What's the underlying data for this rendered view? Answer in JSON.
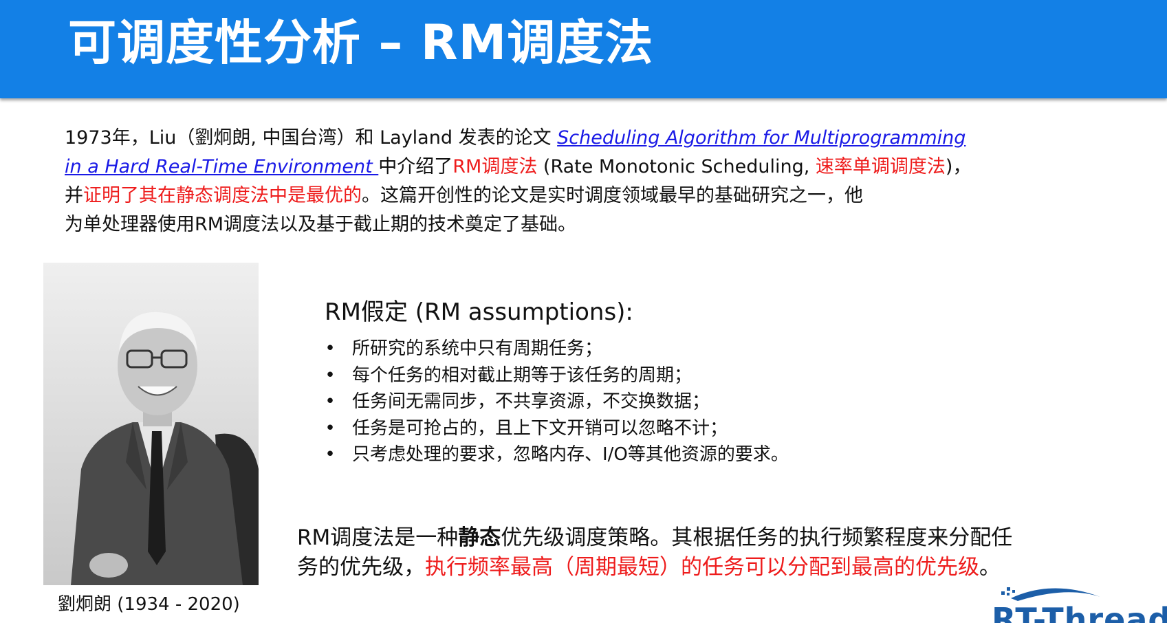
{
  "header": {
    "title": "可调度性分析 – RM调度法"
  },
  "intro": {
    "l1_a": "1973年，Liu（劉炯朗, 中国台湾）和 Layland 发表的论文 ",
    "l1_link": "Scheduling Algorithm for Multiprogramming",
    "l2_link": "in a Hard Real-Time Environment ",
    "l2_b": "中介绍了",
    "l2_red1": "RM调度法",
    "l2_c": " (Rate Monotonic Scheduling, ",
    "l2_red2": "速率单调调度法",
    "l2_d": ")，",
    "l3_a": "并",
    "l3_red": "证明了其在静态调度法中是最优的",
    "l3_b": "。这篇开创性的论文是实时调度领域最早的基础研究之一，他",
    "l4": "为单处理器使用RM调度法以及基于截止期的技术奠定了基础。"
  },
  "photo": {
    "caption": "劉炯朗 (1934 - 2020)"
  },
  "assumptions": {
    "heading": "RM假定 (RM assumptions):",
    "bullet": "•",
    "items": [
      "所研究的系统中只有周期任务；",
      "每个任务的相对截止期等于该任务的周期；",
      "任务间无需同步，不共享资源，不交换数据；",
      "任务是可抢占的，且上下文开销可以忽略不计；",
      "只考虑处理的要求，忽略内存、I/O等其他资源的要求。"
    ]
  },
  "conclusion": {
    "l1_a": "RM调度法是一种",
    "l1_bold": "静态",
    "l1_b": "优先级调度策略。其根据任务的执行频繁程度来分配任",
    "l2_a": "务的优先级，",
    "l2_red": "执行频率最高（周期最短）的任务可以分配到最高的优先级",
    "l2_b": "。"
  },
  "logo": {
    "text": "RT-Thread"
  },
  "colors": {
    "header_bg": "#1380e6",
    "accent_red": "#ee1c1c",
    "link_blue": "#1a1ae6",
    "logo_blue": "#1c5ea8"
  }
}
